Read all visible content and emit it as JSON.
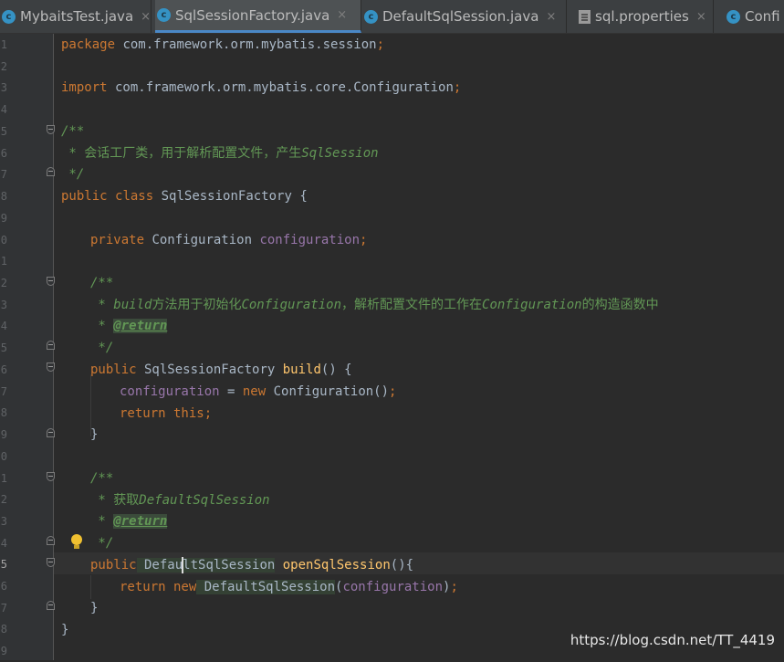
{
  "tabs": [
    {
      "label": "MybaitsTest.java",
      "icon": "class-icon",
      "active": false
    },
    {
      "label": "SqlSessionFactory.java",
      "icon": "class-icon",
      "active": true
    },
    {
      "label": "DefaultSqlSession.java",
      "icon": "class-icon",
      "active": false
    },
    {
      "label": "sql.properties",
      "icon": "properties-icon",
      "active": false
    },
    {
      "label": "Confi",
      "icon": "class-icon",
      "active": false
    }
  ],
  "tab_close_glyph": "×",
  "tab_class_glyph": "c",
  "line_numbers": [
    "1",
    "2",
    "3",
    "4",
    "5",
    "6",
    "7",
    "8",
    "9",
    "0",
    "1",
    "2",
    "3",
    "4",
    "5",
    "6",
    "7",
    "8",
    "9",
    "0",
    "1",
    "2",
    "3",
    "4",
    "5",
    "6",
    "7",
    "8",
    "9"
  ],
  "code": {
    "l1": {
      "kw": "package",
      "rest": " com.framework.orm.mybatis.session",
      "semi": ";"
    },
    "l3": {
      "kw": "import",
      "rest": " com.framework.orm.mybatis.core.Configuration",
      "semi": ";"
    },
    "l5": {
      "text": "/**"
    },
    "l6": {
      "star": " * ",
      "cn": "会话工厂类，用于解析配置文件，产生",
      "it": "SqlSession"
    },
    "l7": {
      "text": " */"
    },
    "l8": {
      "kw1": "public",
      "kw2": "class",
      "name": "SqlSessionFactory",
      "brace": " {"
    },
    "l10": {
      "kw": "private",
      "type": " Configuration ",
      "field": "configuration",
      "semi": ";"
    },
    "l12": {
      "text": "/**"
    },
    "l13": {
      "star": " * ",
      "it1": "build",
      "cn1": "方法用于初始化",
      "it2": "Configuration",
      "cn2": "，解析配置文件的工作在",
      "it3": "Configuration",
      "cn3": "的构造函数中"
    },
    "l14": {
      "star": " * ",
      "tag": "@return"
    },
    "l15": {
      "text": " */"
    },
    "l16": {
      "kw": "public",
      "type": " SqlSessionFactory ",
      "fn": "build",
      "rest": "() {"
    },
    "l17": {
      "field": "configuration",
      "eq": " = ",
      "kw": "new",
      "rest": " Configuration()",
      "semi": ";"
    },
    "l18": {
      "kw1": "return",
      "kw2": " this",
      "semi": ";"
    },
    "l19": {
      "text": "}"
    },
    "l21": {
      "text": "/**"
    },
    "l22": {
      "star": " * ",
      "cn": "获取",
      "it": "DefaultSqlSession"
    },
    "l23": {
      "star": " * ",
      "tag": "@return"
    },
    "l24": {
      "text": " */"
    },
    "l25": {
      "kw": "public",
      "type_a": " Defau",
      "type_b": "ltSqlSession",
      "sp": " ",
      "fn": "openSqlSession",
      "rest": "(){"
    },
    "l26": {
      "kw1": "return",
      "kw2": " new",
      "type": " DefaultSqlSession",
      "p1": "(",
      "field": "configuration",
      "p2": ")",
      "semi": ";"
    },
    "l27": {
      "text": "}"
    },
    "l28": {
      "text": "}"
    }
  },
  "watermark": "https://blog.csdn.net/TT_4419"
}
